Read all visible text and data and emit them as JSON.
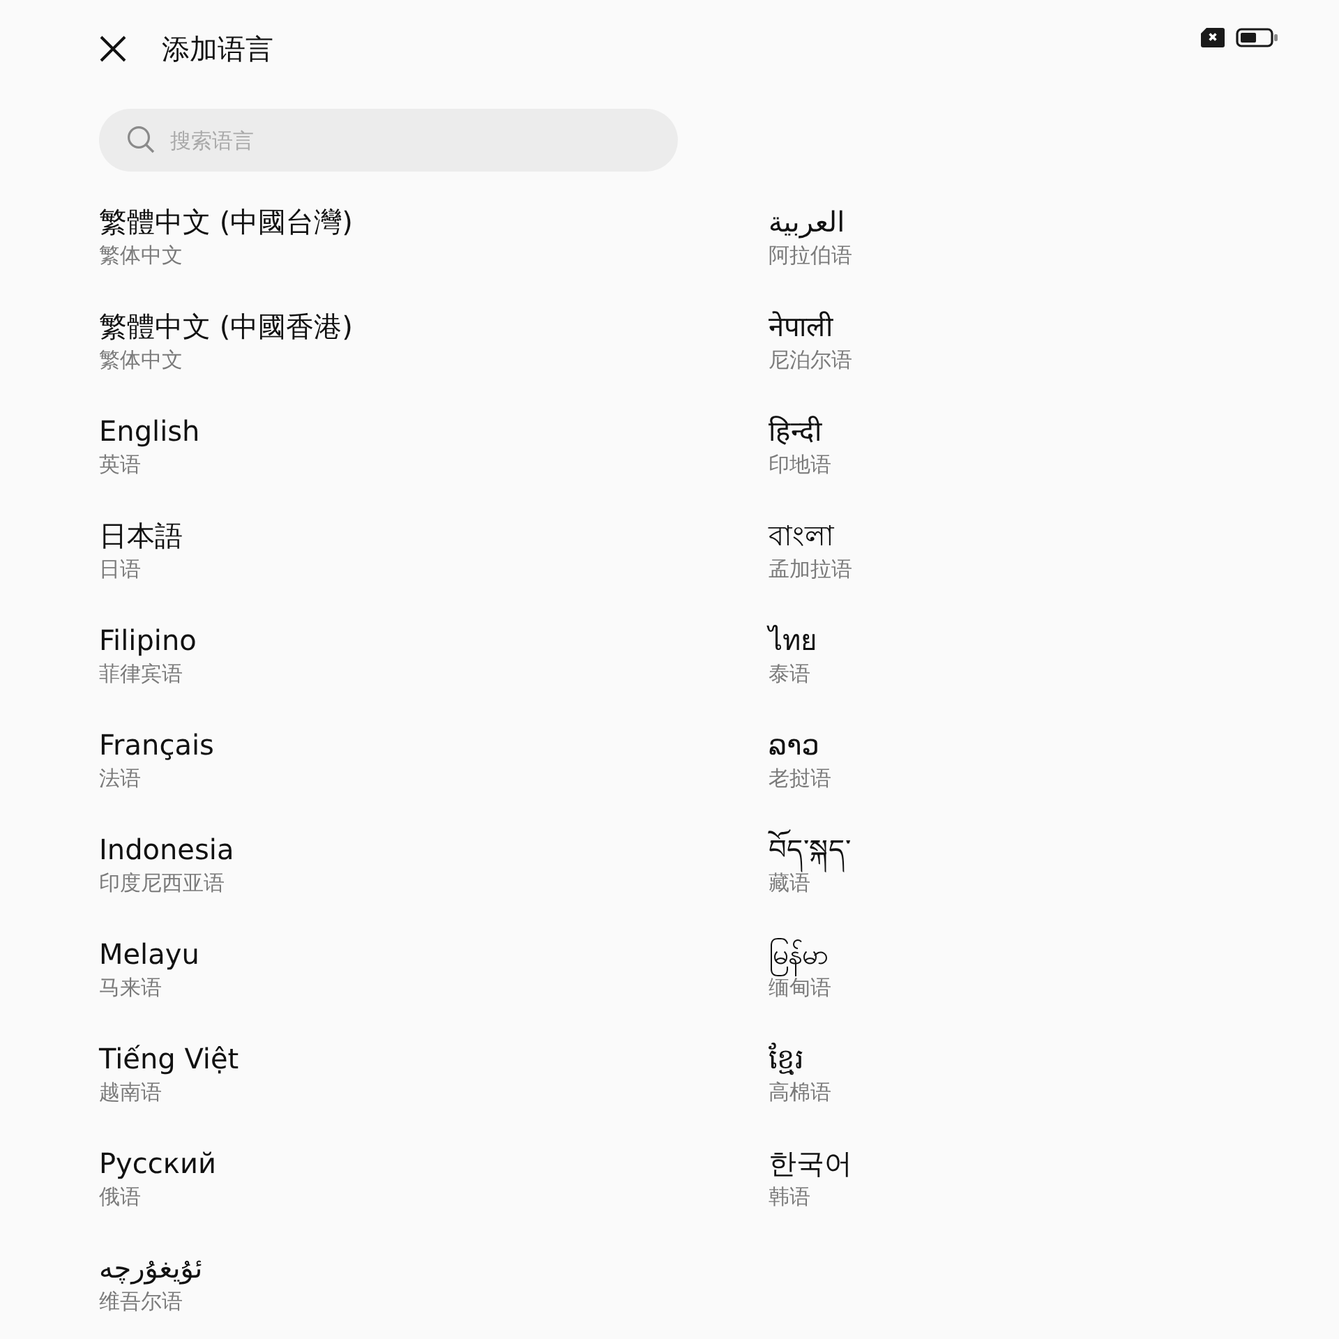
{
  "header": {
    "title": "添加语言"
  },
  "search": {
    "placeholder": "搜索语言"
  },
  "languages": [
    {
      "name": "繁體中文 (中國台灣)",
      "translation": "繁体中文"
    },
    {
      "name": "繁體中文 (中國香港)",
      "translation": "繁体中文"
    },
    {
      "name": "English",
      "translation": "英语"
    },
    {
      "name": "日本語",
      "translation": "日语"
    },
    {
      "name": "Filipino",
      "translation": "菲律宾语"
    },
    {
      "name": "Français",
      "translation": "法语"
    },
    {
      "name": "Indonesia",
      "translation": "印度尼西亚语"
    },
    {
      "name": "Melayu",
      "translation": "马来语"
    },
    {
      "name": "Tiếng Việt",
      "translation": "越南语"
    },
    {
      "name": "Русский",
      "translation": "俄语"
    },
    {
      "name": "ئۇيغۇرچە",
      "translation": "维吾尔语"
    },
    {
      "name": "العربية",
      "translation": "阿拉伯语"
    },
    {
      "name": "नेपाली",
      "translation": "尼泊尔语"
    },
    {
      "name": "हिन्दी",
      "translation": "印地语"
    },
    {
      "name": "বাংলা",
      "translation": "孟加拉语"
    },
    {
      "name": "ไทย",
      "translation": "泰语"
    },
    {
      "name": "ລາວ",
      "translation": "老挝语"
    },
    {
      "name": "བོད་སྐད་",
      "translation": "藏语"
    },
    {
      "name": "မြန်မာ",
      "translation": "缅甸语"
    },
    {
      "name": "ខ្មែរ",
      "translation": "高棉语"
    },
    {
      "name": "한국어",
      "translation": "韩语"
    }
  ]
}
